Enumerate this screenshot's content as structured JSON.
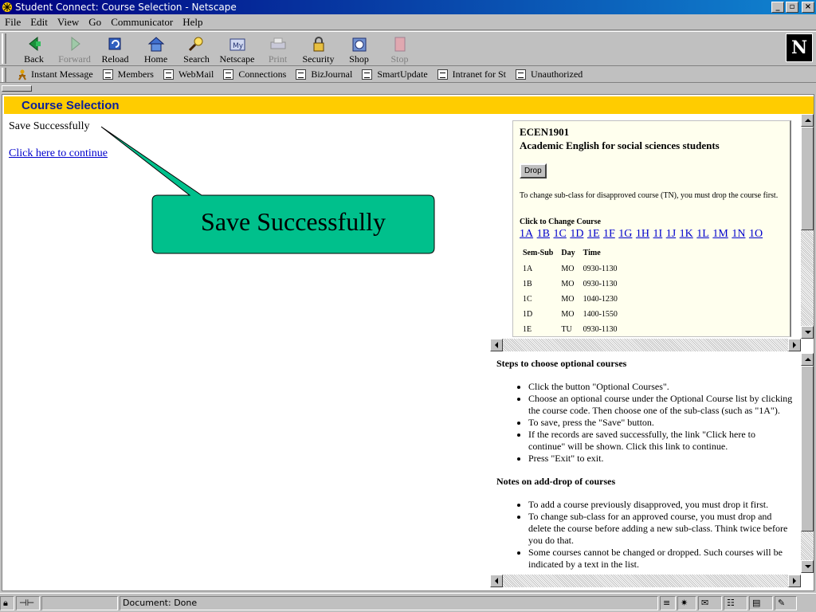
{
  "window": {
    "title": "Student Connect: Course Selection - Netscape"
  },
  "menu": [
    "File",
    "Edit",
    "View",
    "Go",
    "Communicator",
    "Help"
  ],
  "toolbar": [
    {
      "label": "Back",
      "icon": "back-icon",
      "enabled": true
    },
    {
      "label": "Forward",
      "icon": "forward-icon",
      "enabled": false
    },
    {
      "label": "Reload",
      "icon": "reload-icon",
      "enabled": true
    },
    {
      "label": "Home",
      "icon": "home-icon",
      "enabled": true
    },
    {
      "label": "Search",
      "icon": "search-icon",
      "enabled": true
    },
    {
      "label": "Netscape",
      "icon": "netscape-icon",
      "enabled": true
    },
    {
      "label": "Print",
      "icon": "print-icon",
      "enabled": false
    },
    {
      "label": "Security",
      "icon": "lock-icon",
      "enabled": true
    },
    {
      "label": "Shop",
      "icon": "shop-icon",
      "enabled": true
    },
    {
      "label": "Stop",
      "icon": "stop-icon",
      "enabled": false
    }
  ],
  "personal_toolbar": [
    "Instant Message",
    "Members",
    "WebMail",
    "Connections",
    "BizJournal",
    "SmartUpdate",
    "Intranet for St",
    "Unauthorized"
  ],
  "page": {
    "header": "Course Selection",
    "saved_text": "Save Successfully",
    "continue_link": "Click here to continue",
    "callout_text": "Save Successfully"
  },
  "course": {
    "code": "ECEN1901",
    "name": "Academic English for social sciences students",
    "drop_label": "Drop",
    "note": "To change sub-class for disapproved course (TN), you must drop the course first.",
    "change_label": "Click to Change Course",
    "subclasses": [
      "1A",
      "1B",
      "1C",
      "1D",
      "1E",
      "1F",
      "1G",
      "1H",
      "1I",
      "1J",
      "1K",
      "1L",
      "1M",
      "1N",
      "1O"
    ],
    "columns": [
      "Sem-Sub",
      "Day",
      "Time"
    ],
    "rows": [
      [
        "1A",
        "MO",
        "0930-1130"
      ],
      [
        "1B",
        "MO",
        "0930-1130"
      ],
      [
        "1C",
        "MO",
        "1040-1230"
      ],
      [
        "1D",
        "MO",
        "1400-1550"
      ],
      [
        "1E",
        "TU",
        "0930-1130"
      ]
    ]
  },
  "instructions": {
    "steps_title": "Steps to choose optional courses",
    "steps": [
      "Click the button \"Optional Courses\".",
      "Choose an optional course under the Optional Course list by clicking the course code. Then choose one of the sub-class (such as \"1A\").",
      "To save, press the \"Save\" button.",
      "If the records are saved successfully, the link \"Click here to continue\" will be shown. Click this link to continue.",
      "Press \"Exit\" to exit."
    ],
    "notes_title": "Notes on add-drop of courses",
    "notes": [
      "To add a course previously disapproved, you must drop it first.",
      "To change sub-class for an approved course, you must drop and delete the course before adding a new sub-class. Think twice before you do that.",
      "Some courses cannot be changed or dropped. Such courses will be indicated by a text in the list."
    ]
  },
  "status": {
    "text": "Document: Done"
  },
  "colors": {
    "header_bg": "#ffcc00",
    "header_text": "#0a1f9e",
    "callout": "#00c08c",
    "link": "#0000cc"
  }
}
